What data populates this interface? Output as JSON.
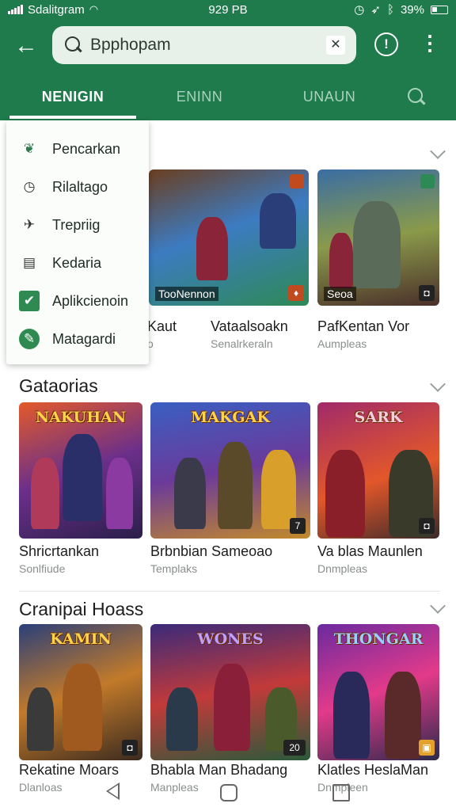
{
  "status": {
    "carrier": "Sdalitgram",
    "time": "929 PB",
    "battery": "39%"
  },
  "header": {
    "back_icon": "arrow-left-icon",
    "search_value": "Bpphopam",
    "clear_icon": "clear-icon",
    "alert_icon": "alert-icon",
    "more_icon": "more-vert-icon"
  },
  "tabs": [
    {
      "label": "NENIGIN",
      "active": true
    },
    {
      "label": "ENINN",
      "active": false
    },
    {
      "label": "UNAUN",
      "active": false
    }
  ],
  "menu": {
    "items": [
      {
        "label": "Pencarkan",
        "icon": "leaf-icon"
      },
      {
        "label": "Rilaltago",
        "icon": "clock-icon"
      },
      {
        "label": "Trepriig",
        "icon": "airplane-icon"
      },
      {
        "label": "Kedaria",
        "icon": "document-icon"
      },
      {
        "label": "Aplikcienoin",
        "icon": "checkbox-icon"
      },
      {
        "label": "Matagardi",
        "icon": "tools-icon"
      }
    ]
  },
  "sections": [
    {
      "title": "",
      "tiles": [
        {
          "name": "Kaut",
          "sub": "o",
          "caption": ""
        },
        {
          "name": "Vataalsoakn",
          "sub": "Senalrkeraln",
          "caption": "TooNennon"
        },
        {
          "name": "PafKentan Vor",
          "sub": "Aumpleas",
          "caption": "Seoa"
        }
      ]
    },
    {
      "title": "Gataorias",
      "tiles": [
        {
          "name": "Shricrtankan",
          "sub": "Sonlfiude",
          "art": "NAKUHAN"
        },
        {
          "name": "Brbnbian Sameoao",
          "sub": "Templaks",
          "art": "MAKGAK"
        },
        {
          "name": "Va blas Maunlen",
          "sub": "Dnmpleas",
          "art": "SARK"
        }
      ]
    },
    {
      "title": "Cranipai Hoass",
      "tiles": [
        {
          "name": "Rekatine Moars",
          "sub": "Dlanloas",
          "art": "KAMIN"
        },
        {
          "name": "Bhabla Man Bhadang",
          "sub": "Manpleas",
          "art": "WONES"
        },
        {
          "name": "Klatles HeslaMan",
          "sub": "Dnmpleen",
          "art": "THONGAR"
        }
      ]
    }
  ],
  "nav": {
    "back_icon": "nav-back-icon",
    "home_icon": "nav-home-icon",
    "recent_icon": "nav-recent-icon"
  }
}
